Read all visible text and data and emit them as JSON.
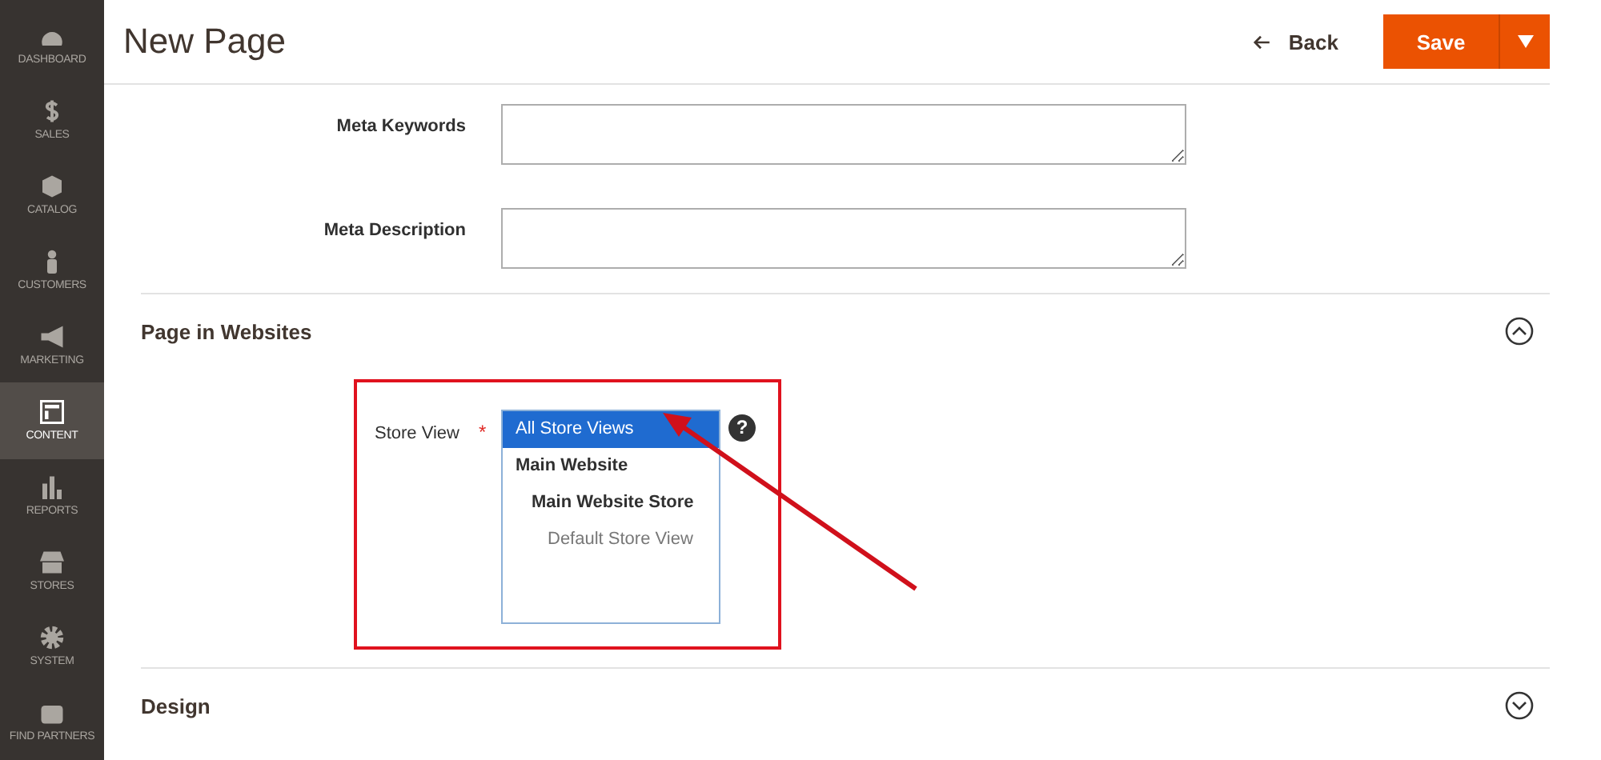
{
  "sidebar": {
    "items": [
      {
        "label": "DASHBOARD",
        "selected": false
      },
      {
        "label": "SALES",
        "selected": false
      },
      {
        "label": "CATALOG",
        "selected": false
      },
      {
        "label": "CUSTOMERS",
        "selected": false
      },
      {
        "label": "MARKETING",
        "selected": false
      },
      {
        "label": "CONTENT",
        "selected": true
      },
      {
        "label": "REPORTS",
        "selected": false
      },
      {
        "label": "STORES",
        "selected": false
      },
      {
        "label": "SYSTEM",
        "selected": false
      },
      {
        "label": "FIND PARTNERS",
        "selected": false
      }
    ]
  },
  "header": {
    "title": "New Page",
    "back": "Back",
    "save": "Save"
  },
  "fields": [
    {
      "label": "Meta Keywords"
    },
    {
      "label": "Meta Description"
    }
  ],
  "sections": [
    {
      "title": "Page in Websites",
      "expanded": true,
      "store_view": {
        "label": "Store View",
        "required_mark": "*",
        "help": "?",
        "options": [
          {
            "label": "All Store Views",
            "kind": "all",
            "selected": true
          },
          {
            "label": "Main Website",
            "kind": "website",
            "selected": false,
            "children": [
              {
                "label": "Main Website Store",
                "kind": "store",
                "selected": false,
                "children": [
                  {
                    "label": "Default Store View",
                    "kind": "view",
                    "selected": false
                  }
                ]
              }
            ]
          }
        ]
      }
    },
    {
      "title": "Design",
      "expanded": false
    }
  ]
}
